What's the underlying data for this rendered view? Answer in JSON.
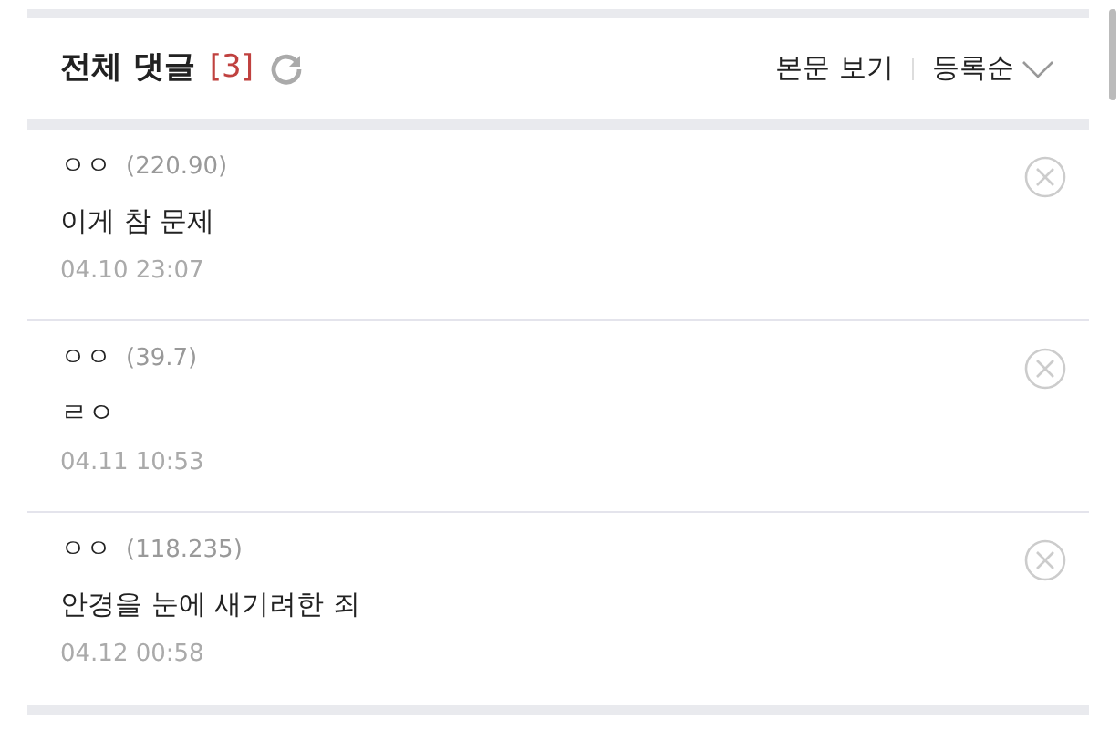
{
  "header": {
    "title": "전체 댓글",
    "count": "[3]",
    "view_post": "본문 보기",
    "sort": "등록순"
  },
  "comments": [
    {
      "author": "ㅇㅇ",
      "ip": "(220.90)",
      "text": "이게 참 문제",
      "date": "04.10 23:07"
    },
    {
      "author": "ㅇㅇ",
      "ip": "(39.7)",
      "text": "ㄹㅇ",
      "date": "04.11 10:53"
    },
    {
      "author": "ㅇㅇ",
      "ip": "(118.235)",
      "text": "안경을 눈에 새기려한 죄",
      "date": "04.12 00:58"
    }
  ]
}
